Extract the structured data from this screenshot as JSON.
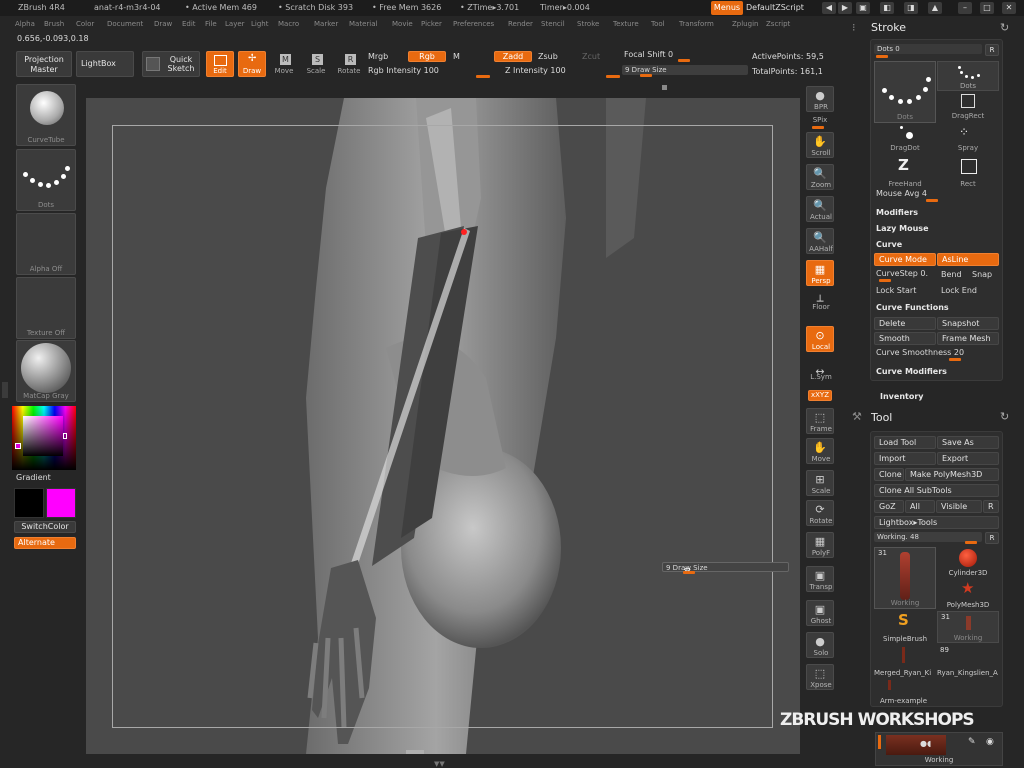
{
  "titlebar": {
    "app": "ZBrush 4R4",
    "document": "anat-r4-m3r4-04",
    "active_mem": "• Active Mem 469",
    "scratch_disk": "• Scratch Disk 393",
    "free_mem": "• Free Mem 3626",
    "ztime": "• ZTime▸3.701",
    "timer": "Timer▸0.004",
    "menus_label": "Menus",
    "script_label": "DefaultZScript"
  },
  "menubar": [
    "Alpha",
    "Brush",
    "Color",
    "Document",
    "Draw",
    "Edit",
    "File",
    "Layer",
    "Light",
    "Macro",
    "Marker",
    "Material",
    "Movie",
    "Picker",
    "Preferences",
    "Render",
    "Stencil",
    "Stroke",
    "Texture",
    "Tool",
    "Transform",
    "Zplugin",
    "Zscript"
  ],
  "coords": "0.656,-0.093,0.18",
  "shelf": {
    "projection_master": "Projection Master",
    "lightbox": "LightBox",
    "quick_sketch": "Quick Sketch",
    "edit": "Edit",
    "draw": "Draw",
    "move": "Move",
    "scale": "Scale",
    "rotate": "Rotate",
    "mrgb": "Mrgb",
    "rgb": "Rgb",
    "m": "M",
    "rgb_intensity": "Rgb Intensity 100",
    "zadd": "Zadd",
    "zsub": "Zsub",
    "zcut": "Zcut",
    "z_intensity": "Z Intensity 100",
    "focal_shift": "Focal Shift 0",
    "draw_size": "9 Draw Size",
    "active_points": "ActivePoints: 59,5",
    "total_points": "TotalPoints: 161,1"
  },
  "left_shelf": {
    "brush_name": "CurveTube",
    "stroke_name": "Dots",
    "alpha_name": "Alpha Off",
    "texture_name": "Texture Off",
    "material_name": "MatCap Gray",
    "gradient": "Gradient",
    "switch_color": "SwitchColor",
    "alternate": "Alternate"
  },
  "right_shelf": [
    "BPR",
    "SPix",
    "Scroll",
    "Zoom",
    "Actual",
    "AAHalf",
    "Persp",
    "Floor",
    "Local",
    "L.Sym",
    "xXYZ",
    "Frame",
    "Move",
    "Scale",
    "Rotate",
    "PolyF",
    "Transp",
    "Ghost",
    "Solo",
    "Xpose"
  ],
  "canvas_popup": "9 Draw Size",
  "watermark": "ZBRUSH WORKSHOPS",
  "stroke_palette": {
    "title": "Stroke",
    "dots": "Dots 0",
    "r": "R",
    "stroke_types": [
      "Dots",
      "Dots",
      "DragRect",
      "DragDot",
      "Spray",
      "FreeHand",
      "Rect"
    ],
    "mouse_avg": "Mouse Avg 4",
    "modifiers": "Modifiers",
    "lazy_mouse": "Lazy Mouse",
    "curve": "Curve",
    "curve_mode": "Curve Mode",
    "as_line": "AsLine",
    "curve_step": "CurveStep 0.",
    "bend": "Bend",
    "snap": "Snap",
    "lock_start": "Lock Start",
    "lock_end": "Lock End",
    "curve_functions": "Curve Functions",
    "delete": "Delete",
    "snapshot": "Snapshot",
    "smooth": "Smooth",
    "frame_mesh": "Frame Mesh",
    "curve_smoothness": "Curve Smoothness 20",
    "curve_modifiers": "Curve Modifiers"
  },
  "inventory": "Inventory",
  "tool_palette": {
    "title": "Tool",
    "load_tool": "Load Tool",
    "save_as": "Save As",
    "import": "Import",
    "export": "Export",
    "clone": "Clone",
    "make_polymesh": "Make PolyMesh3D",
    "clone_all": "Clone All SubTools",
    "goz": "GoZ",
    "all": "All",
    "visible": "Visible",
    "r": "R",
    "lightbox_tools": "Lightbox▸Tools",
    "working": "Working. 48",
    "thumb_count": "31",
    "tools": [
      {
        "name": "Working"
      },
      {
        "name": "Cylinder3D"
      },
      {
        "name": "PolyMesh3D"
      },
      {
        "name": "SimpleBrush"
      },
      {
        "name": "Working",
        "count": "31"
      },
      {
        "name": "Merged_Ryan_Ki"
      },
      {
        "name": "Ryan_Kingslien_A",
        "count": "89"
      },
      {
        "name": "Arm-example"
      }
    ],
    "bottom_label": "Working"
  },
  "colors": {
    "accent": "#e86a10",
    "secondary": "#ff00ff",
    "primary": "#000000"
  }
}
